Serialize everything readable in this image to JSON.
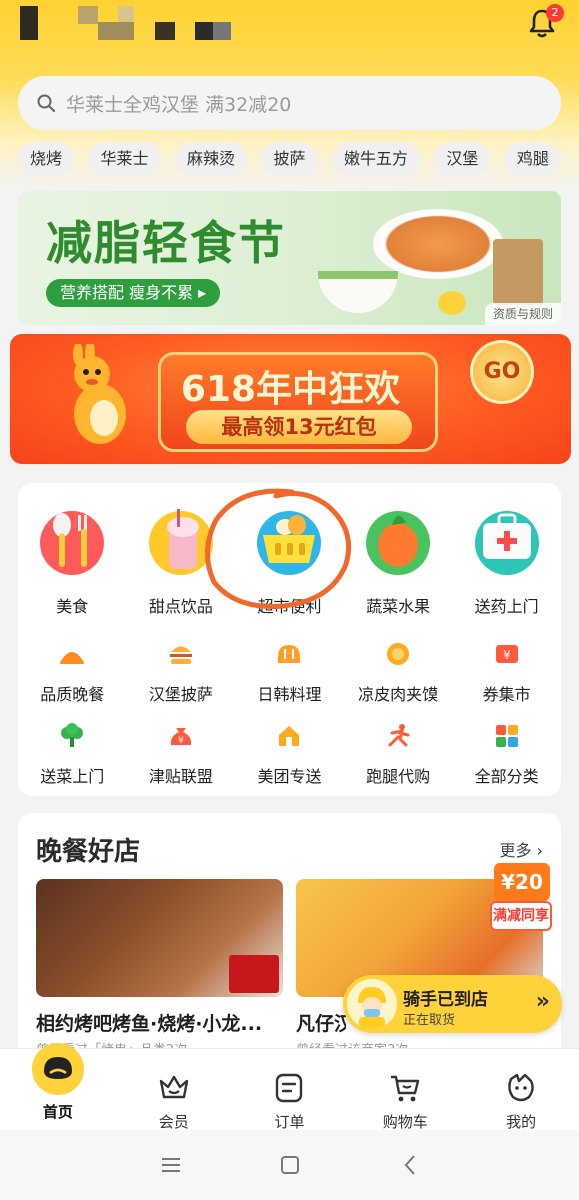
{
  "status_bar": {
    "notification_count": "2"
  },
  "search": {
    "placeholder": "华莱士全鸡汉堡 满32减20"
  },
  "chips": [
    "烧烤",
    "华莱士",
    "麻辣烫",
    "披萨",
    "嫩牛五方",
    "汉堡",
    "鸡腿"
  ],
  "banner1": {
    "title": "减脂轻食节",
    "pill": "营养搭配 瘦身不累 ▸",
    "rule": "资质与规则"
  },
  "banner2": {
    "title": "618年中狂欢",
    "subtitle": "最高领13元红包",
    "go": "GO"
  },
  "categories_big": [
    {
      "label": "美食",
      "icon": "utensils-icon"
    },
    {
      "label": "甜点饮品",
      "icon": "dessert-icon"
    },
    {
      "label": "超市便利",
      "icon": "basket-icon"
    },
    {
      "label": "蔬菜水果",
      "icon": "carrot-icon"
    },
    {
      "label": "送药上门",
      "icon": "medkit-icon"
    }
  ],
  "categories_small_1": [
    {
      "label": "品质晚餐",
      "icon": "dinner-icon"
    },
    {
      "label": "汉堡披萨",
      "icon": "burger-icon"
    },
    {
      "label": "日韩料理",
      "icon": "bread-icon"
    },
    {
      "label": "凉皮肉夹馍",
      "icon": "bun-icon"
    },
    {
      "label": "券集市",
      "icon": "coupon-icon"
    }
  ],
  "categories_small_2": [
    {
      "label": "送菜上门",
      "icon": "vegetable-icon"
    },
    {
      "label": "津贴联盟",
      "icon": "money-bag-icon"
    },
    {
      "label": "美团专送",
      "icon": "delivery-icon"
    },
    {
      "label": "跑腿代购",
      "icon": "runner-icon"
    },
    {
      "label": "全部分类",
      "icon": "grid-icon"
    }
  ],
  "shops": {
    "title": "晚餐好店",
    "more": "更多 ›",
    "coupon_amount": "¥20",
    "coupon_label": "满减同享",
    "items": [
      {
        "name": "相约烤吧烤鱼·烧烤·小龙...",
        "sub": "曾经看过「烤串」品类2次"
      },
      {
        "name": "凡仔汉",
        "sub": "曾经看过该商家3次"
      }
    ]
  },
  "rider": {
    "title": "骑手已到店",
    "subtitle": "正在取货",
    "arrow": "»"
  },
  "tabbar": [
    {
      "label": "首页",
      "icon": "home-face-icon"
    },
    {
      "label": "会员",
      "icon": "crown-icon"
    },
    {
      "label": "订单",
      "icon": "order-icon"
    },
    {
      "label": "购物车",
      "icon": "cart-icon"
    },
    {
      "label": "我的",
      "icon": "profile-icon"
    }
  ],
  "colors": {
    "brand_yellow": "#ffd23a",
    "accent_orange": "#ff5a21",
    "annotation_orange": "#f2682a"
  }
}
